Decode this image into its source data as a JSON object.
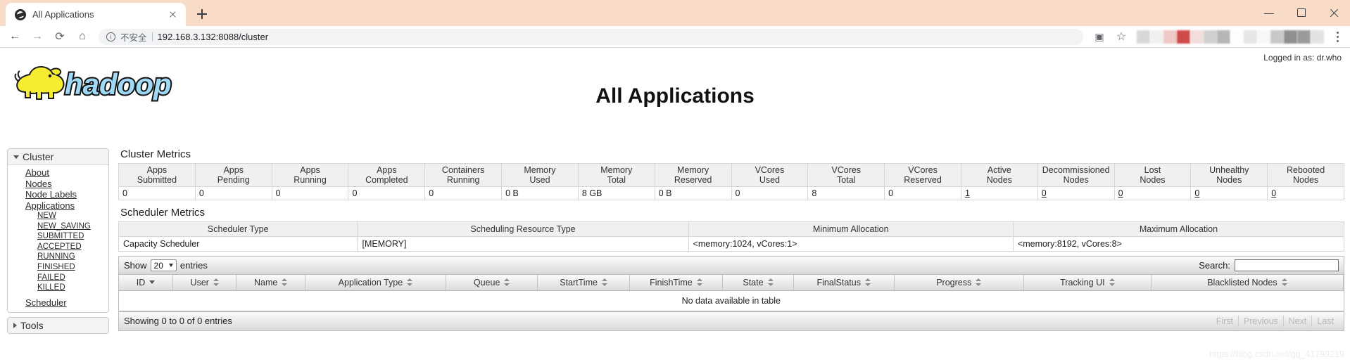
{
  "browser": {
    "tab_title": "All Applications",
    "new_tab_label": "+",
    "url": "192.168.3.132:8088/cluster",
    "security_label": "不安全",
    "back_icon": "back-arrow-icon",
    "forward_icon": "forward-arrow-icon",
    "reload_icon": "reload-icon",
    "home_icon": "home-icon"
  },
  "header": {
    "logo_text": "hadoop",
    "logged_in": "Logged in as: dr.who",
    "page_title": "All Applications"
  },
  "sidebar": {
    "cluster": {
      "label": "Cluster",
      "links": [
        "About",
        "Nodes",
        "Node Labels",
        "Applications"
      ],
      "app_states": [
        "NEW",
        "NEW_SAVING",
        "SUBMITTED",
        "ACCEPTED",
        "RUNNING",
        "FINISHED",
        "FAILED",
        "KILLED"
      ],
      "scheduler": "Scheduler"
    },
    "tools": {
      "label": "Tools"
    }
  },
  "cluster_metrics": {
    "title": "Cluster Metrics",
    "columns": [
      "Apps Submitted",
      "Apps Pending",
      "Apps Running",
      "Apps Completed",
      "Containers Running",
      "Memory Used",
      "Memory Total",
      "Memory Reserved",
      "VCores Used",
      "VCores Total",
      "VCores Reserved",
      "Active Nodes",
      "Decommissioned Nodes",
      "Lost Nodes",
      "Unhealthy Nodes",
      "Rebooted Nodes"
    ],
    "values": [
      "0",
      "0",
      "0",
      "0",
      "0",
      "0 B",
      "8 GB",
      "0 B",
      "0",
      "8",
      "0",
      "1",
      "0",
      "0",
      "0",
      "0"
    ],
    "link_flags": [
      false,
      false,
      false,
      false,
      false,
      false,
      false,
      false,
      false,
      false,
      false,
      true,
      true,
      true,
      true,
      true
    ]
  },
  "scheduler_metrics": {
    "title": "Scheduler Metrics",
    "columns": [
      "Scheduler Type",
      "Scheduling Resource Type",
      "Minimum Allocation",
      "Maximum Allocation"
    ],
    "row": [
      "Capacity Scheduler",
      "[MEMORY]",
      "<memory:1024, vCores:1>",
      "<memory:8192, vCores:8>"
    ]
  },
  "apps_table": {
    "show_label": "Show",
    "entries_label": "entries",
    "page_length": "20",
    "search_label": "Search:",
    "search_value": "",
    "search_placeholder": "",
    "columns": [
      {
        "label": "ID",
        "sort": "desc"
      },
      {
        "label": "User",
        "sort": "both"
      },
      {
        "label": "Name",
        "sort": "both"
      },
      {
        "label": "Application Type",
        "sort": "both"
      },
      {
        "label": "Queue",
        "sort": "both"
      },
      {
        "label": "StartTime",
        "sort": "both"
      },
      {
        "label": "FinishTime",
        "sort": "both"
      },
      {
        "label": "State",
        "sort": "both"
      },
      {
        "label": "FinalStatus",
        "sort": "both"
      },
      {
        "label": "Progress",
        "sort": "both"
      },
      {
        "label": "Tracking UI",
        "sort": "both"
      },
      {
        "label": "Blacklisted Nodes",
        "sort": "both"
      }
    ],
    "empty_message": "No data available in table",
    "info": "Showing 0 to 0 of 0 entries",
    "pagination": [
      "First",
      "Previous",
      "Next",
      "Last"
    ]
  },
  "watermark": "https://blog.csdn.net/qq_41799219"
}
